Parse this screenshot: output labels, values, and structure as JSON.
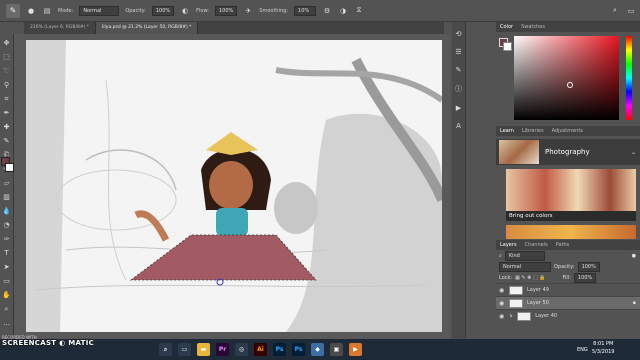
{
  "options_bar": {
    "mode_label": "Mode:",
    "mode_value": "Normal",
    "opacity_label": "Opacity:",
    "opacity_value": "100%",
    "flow_label": "Flow:",
    "flow_value": "100%",
    "smoothing_label": "Smoothing:",
    "smoothing_value": "10%"
  },
  "tabs": [
    {
      "label": "220% (Layer 6, RGB/8#) *"
    },
    {
      "label": "lilya.psd @ 21.2% (Layer 50, RGB/8#) *"
    }
  ],
  "panels": {
    "color_tabs": [
      "Color",
      "Swatches"
    ],
    "learn_tabs": [
      "Learn",
      "Libraries",
      "Adjustments"
    ],
    "library_title": "Photography",
    "library_item": "Bring out colors",
    "layers_tabs": [
      "Layers",
      "Channels",
      "Paths"
    ],
    "kind_label": "Kind",
    "blend_mode": "Normal",
    "opacity_label": "Opacity:",
    "opacity_value": "100%",
    "lock_label": "Lock:",
    "fill_label": "Fill:",
    "fill_value": "100%",
    "layers": [
      {
        "name": "Layer 49"
      },
      {
        "name": "Layer 50"
      },
      {
        "name": "Layer 40"
      }
    ]
  },
  "taskbar": {
    "watermark": "SCREENCAST ◐ MATIC",
    "watermark_sub": "RECORDED WITH",
    "lang": "ENG",
    "time": "8:01 PM",
    "date": "5/3/2019"
  },
  "colors": {
    "foreground": "#6b4145",
    "background": "#ffffff",
    "accent": "#31a8ff"
  }
}
